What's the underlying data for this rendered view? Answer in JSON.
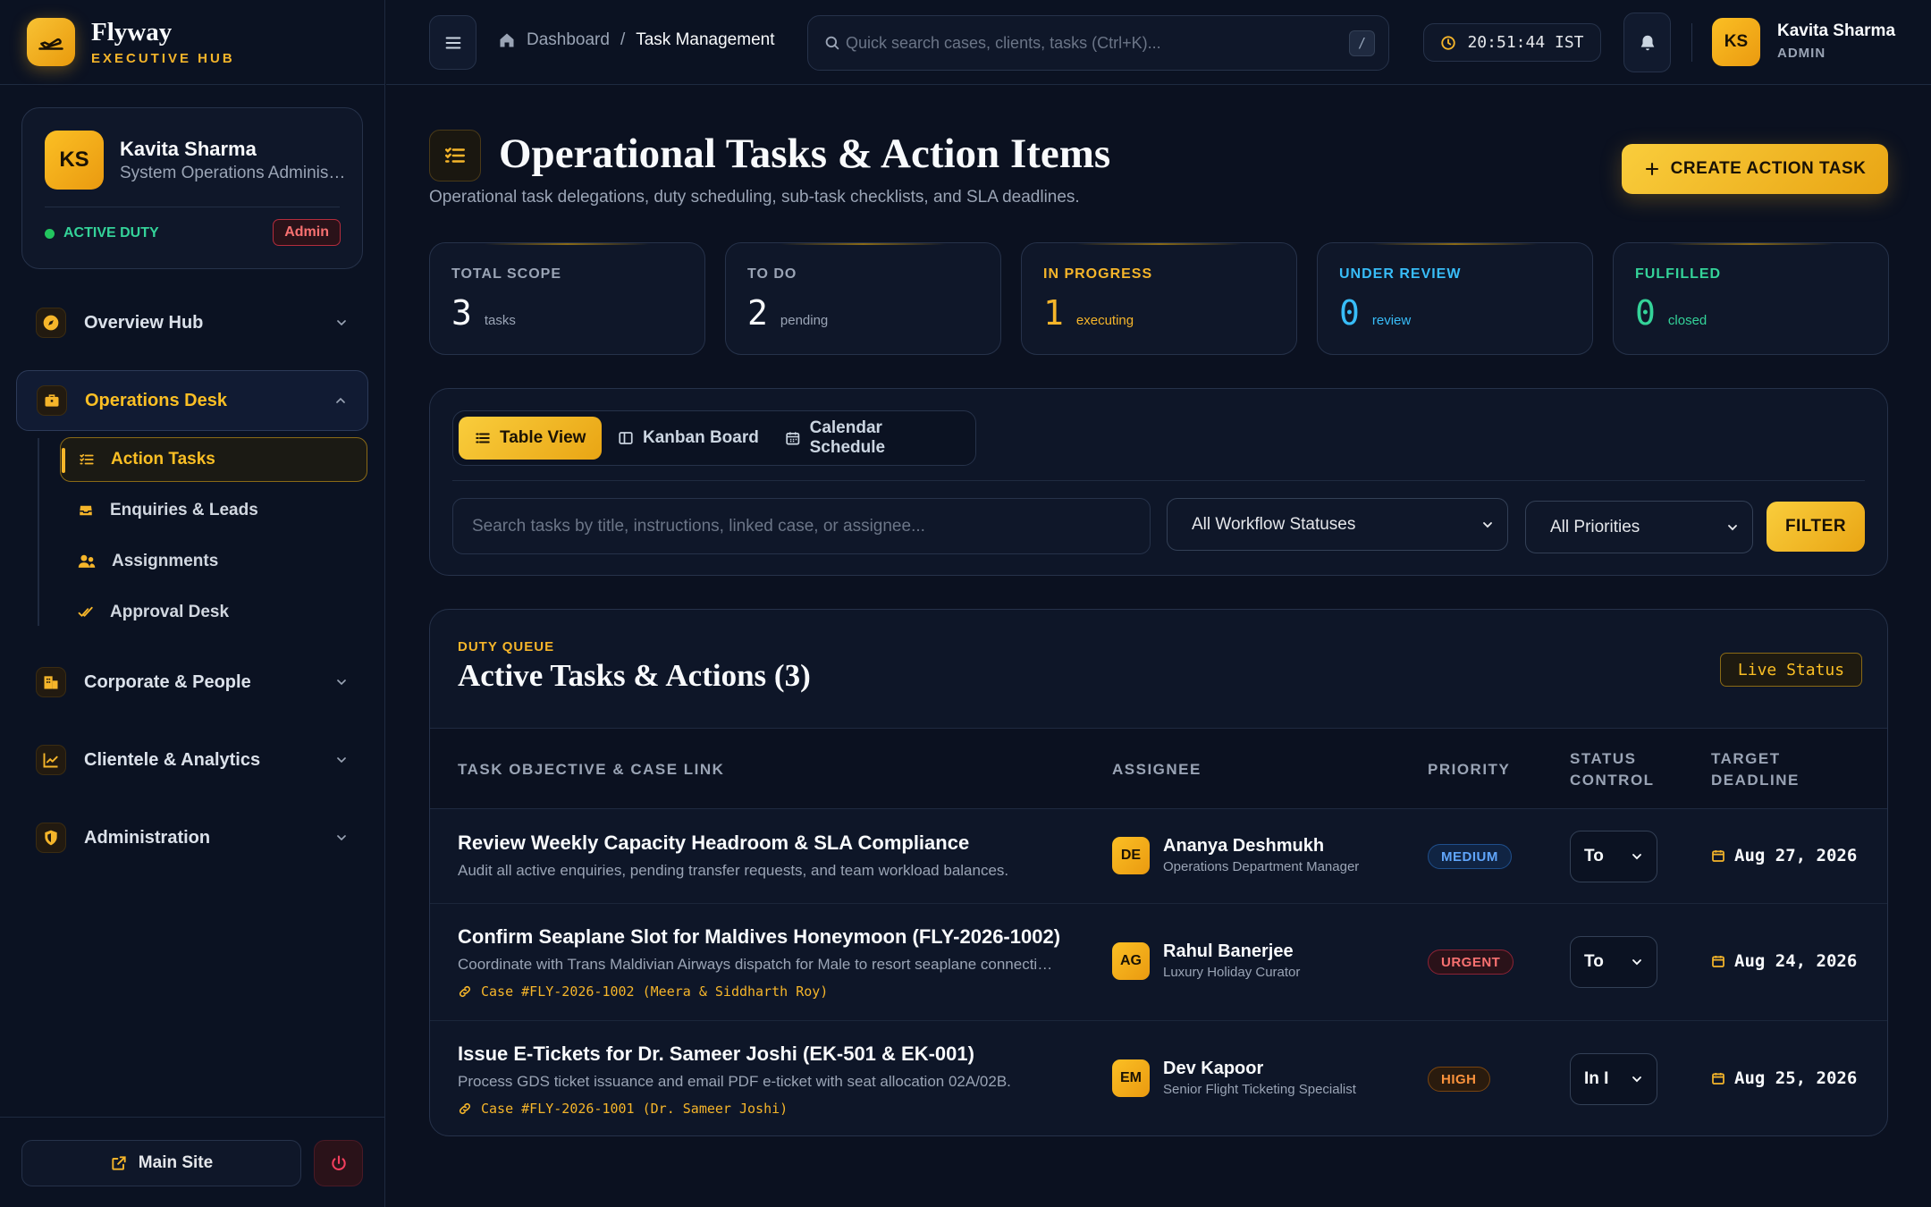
{
  "brand": {
    "name": "Flyway",
    "subtitle": "EXECUTIVE HUB"
  },
  "profile": {
    "initials": "KS",
    "name": "Kavita Sharma",
    "role": "System Operations Administrator",
    "duty_status": "ACTIVE DUTY",
    "badge": "Admin"
  },
  "nav": {
    "overview": "Overview Hub",
    "operations": "Operations Desk",
    "operations_items": [
      "Action Tasks",
      "Enquiries & Leads",
      "Assignments",
      "Approval Desk"
    ],
    "corporate": "Corporate & People",
    "clientele": "Clientele & Analytics",
    "administration": "Administration"
  },
  "footer": {
    "main_site": "Main Site"
  },
  "topbar": {
    "breadcrumb_home": "Dashboard",
    "breadcrumb_sep": "/",
    "breadcrumb_current": "Task Management",
    "search_placeholder": "Quick search cases, clients, tasks (Ctrl+K)...",
    "search_shortcut": "/",
    "clock": "20:51:44 IST",
    "user_initials": "KS",
    "user_name": "Kavita Sharma",
    "user_role": "ADMIN"
  },
  "page": {
    "title": "Operational Tasks & Action Items",
    "subtitle": "Operational task delegations, duty scheduling, sub-task checklists, and SLA deadlines.",
    "create_button": "CREATE ACTION TASK"
  },
  "stats": [
    {
      "label": "TOTAL SCOPE",
      "value": "3",
      "unit": "tasks",
      "color": "#9aa4b5"
    },
    {
      "label": "TO DO",
      "value": "2",
      "unit": "pending",
      "color": "#9aa4b5"
    },
    {
      "label": "IN PROGRESS",
      "value": "1",
      "unit": "executing",
      "color": "#f5b52a"
    },
    {
      "label": "UNDER REVIEW",
      "value": "0",
      "unit": "review",
      "color": "#38bdf8"
    },
    {
      "label": "FULFILLED",
      "value": "0",
      "unit": "closed",
      "color": "#34d399"
    }
  ],
  "views": {
    "table": "Table View",
    "kanban": "Kanban Board",
    "calendar": "Calendar Schedule"
  },
  "filters": {
    "search_placeholder": "Search tasks by title, instructions, linked case, or assignee...",
    "status": "All Workflow Statuses",
    "priority": "All Priorities",
    "button": "FILTER"
  },
  "queue": {
    "eyebrow": "DUTY QUEUE",
    "title": "Active Tasks & Actions (3)",
    "live": "Live Status",
    "columns": {
      "task": "TASK OBJECTIVE & CASE LINK",
      "assignee": "ASSIGNEE",
      "priority": "PRIORITY",
      "status": "STATUS CONTROL",
      "deadline": "TARGET DEADLINE"
    },
    "rows": [
      {
        "title": "Review Weekly Capacity Headroom & SLA Compliance",
        "desc": "Audit all active enquiries, pending transfer requests, and team workload balances.",
        "case": "",
        "initials": "DE",
        "assignee": "Ananya Deshmukh",
        "assignee_role": "Operations Department Manager",
        "priority": "MEDIUM",
        "status": "To",
        "deadline": "Aug 27, 2026"
      },
      {
        "title": "Confirm Seaplane Slot for Maldives Honeymoon (FLY-2026-1002)",
        "desc": "Coordinate with Trans Maldivian Airways dispatch for Male to resort seaplane connection.",
        "case": "Case #FLY-2026-1002 (Meera & Siddharth Roy)",
        "initials": "AG",
        "assignee": "Rahul Banerjee",
        "assignee_role": "Luxury Holiday Curator",
        "priority": "URGENT",
        "status": "To",
        "deadline": "Aug 24, 2026"
      },
      {
        "title": "Issue E-Tickets for Dr. Sameer Joshi (EK-501 & EK-001)",
        "desc": "Process GDS ticket issuance and email PDF e-ticket with seat allocation 02A/02B.",
        "case": "Case #FLY-2026-1001 (Dr. Sameer Joshi)",
        "initials": "EM",
        "assignee": "Dev Kapoor",
        "assignee_role": "Senior Flight Ticketing Specialist",
        "priority": "HIGH",
        "status": "In I",
        "deadline": "Aug 25, 2026"
      }
    ]
  }
}
